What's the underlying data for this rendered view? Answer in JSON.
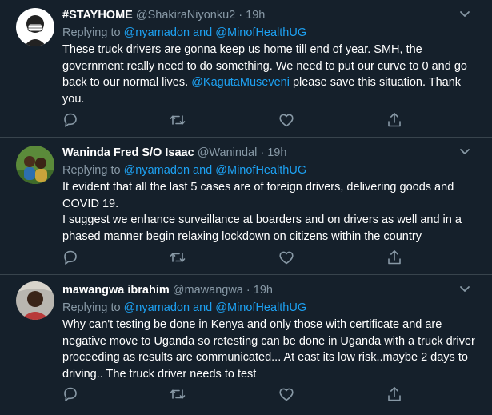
{
  "tweets": [
    {
      "name": "#STAYHOME",
      "handle": "@ShakiraNiyonku2",
      "dot": "·",
      "time": "19h",
      "replying_prefix": "Replying to",
      "replying_to_1": "@nyamadon",
      "replying_and": "and",
      "replying_to_2": "@MinofHealthUG",
      "text_1": "These truck drivers are gonna keep us home till end of year. SMH, the government really need to do something. We need to put our curve to 0 and go back to our normal lives. ",
      "text_mention": "@KagutaMuseveni",
      "text_2": " please save this situation. Thank you."
    },
    {
      "name": "Waninda Fred S/O Isaac",
      "handle": "@Wanindal",
      "dot": "·",
      "time": "19h",
      "replying_prefix": "Replying to",
      "replying_to_1": "@nyamadon",
      "replying_and": "and",
      "replying_to_2": "@MinofHealthUG",
      "text_line_1": "It evident that all the last 5 cases are of foreign drivers, delivering goods and COVID 19.",
      "text_line_2": "I suggest we enhance surveillance at boarders and on drivers as well and in a phased manner begin relaxing lockdown on citizens within the country"
    },
    {
      "name": "mawangwa ibrahim",
      "handle": "@mawangwa",
      "dot": "·",
      "time": "19h",
      "replying_prefix": "Replying to",
      "replying_to_1": "@nyamadon",
      "replying_and": "and",
      "replying_to_2": "@MinofHealthUG",
      "text": "Why can't testing be done in Kenya and only those with certificate and are negative move to Uganda so retesting can be done in Uganda with a truck driver proceeding as results are communicated... At east its low risk..maybe 2 days to driving.. The truck driver needs to test"
    }
  ],
  "icons": {
    "reply": "reply-icon",
    "retweet": "retweet-icon",
    "like": "heart-icon",
    "share": "share-icon",
    "caret": "chevron-down-icon"
  },
  "colors": {
    "background": "#15202b",
    "divider": "#38444d",
    "secondary_text": "#8899a6",
    "link": "#1da1f2"
  }
}
